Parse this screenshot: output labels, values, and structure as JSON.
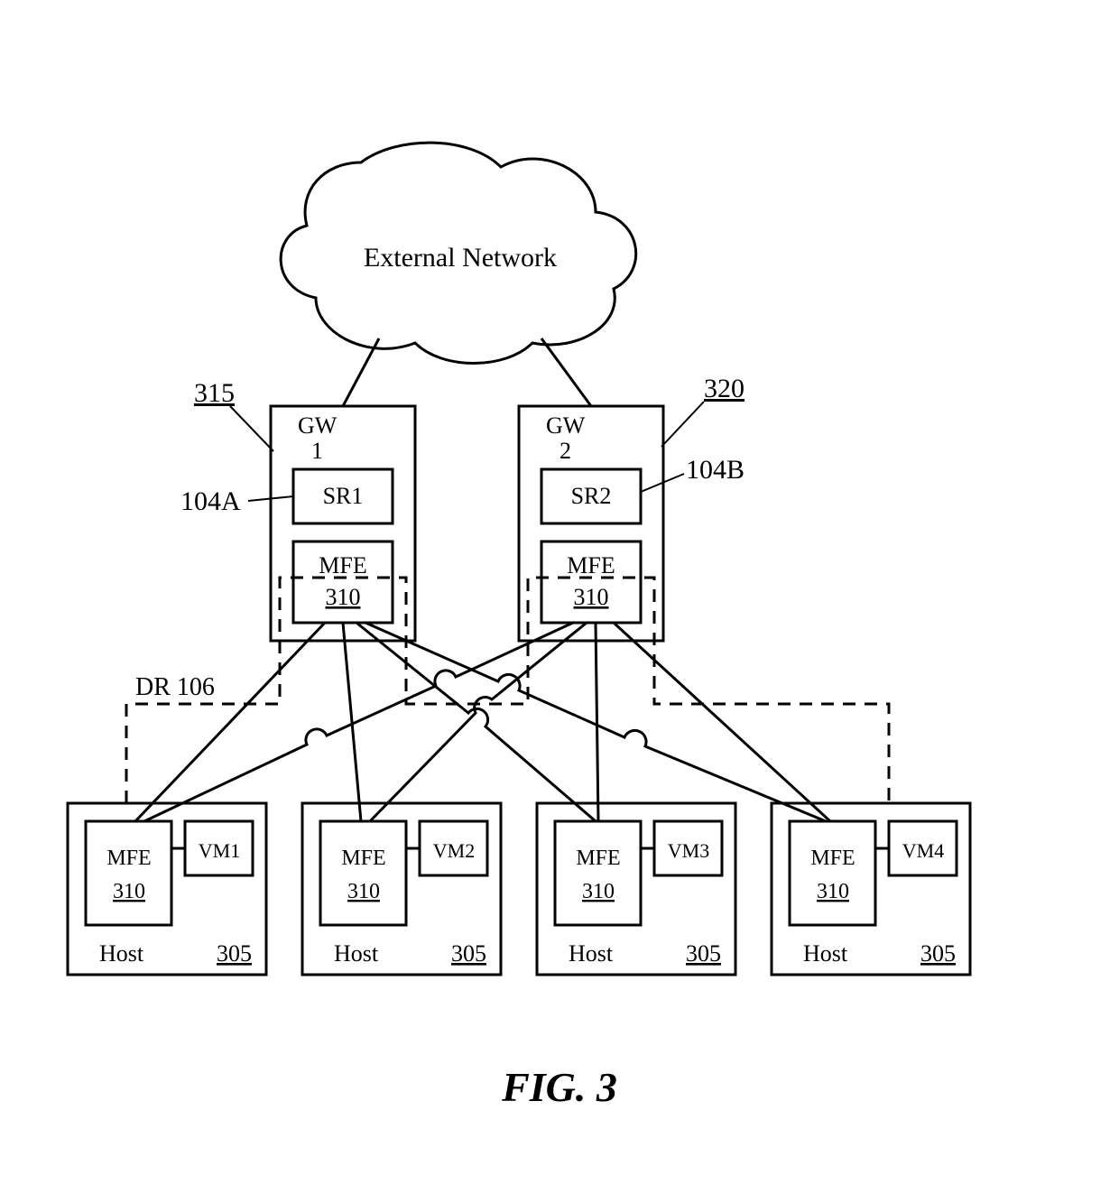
{
  "figure_label": "FIG. 3",
  "cloud": {
    "label": "External Network"
  },
  "gw1": {
    "title": "GW 1",
    "ref": "315",
    "sr_label": "SR1",
    "sr_ref": "104A",
    "mfe_label": "MFE",
    "mfe_ref": "310"
  },
  "gw2": {
    "title": "GW 2",
    "ref": "320",
    "sr_label": "SR2",
    "sr_ref": "104B",
    "mfe_label": "MFE",
    "mfe_ref": "310"
  },
  "dr_label": "DR 106",
  "hosts": [
    {
      "mfe_label": "MFE",
      "mfe_ref": "310",
      "vm_label": "VM1",
      "host_label": "Host",
      "host_ref": "305"
    },
    {
      "mfe_label": "MFE",
      "mfe_ref": "310",
      "vm_label": "VM2",
      "host_label": "Host",
      "host_ref": "305"
    },
    {
      "mfe_label": "MFE",
      "mfe_ref": "310",
      "vm_label": "VM3",
      "host_label": "Host",
      "host_ref": "305"
    },
    {
      "mfe_label": "MFE",
      "mfe_ref": "310",
      "vm_label": "VM4",
      "host_label": "Host",
      "host_ref": "305"
    }
  ]
}
